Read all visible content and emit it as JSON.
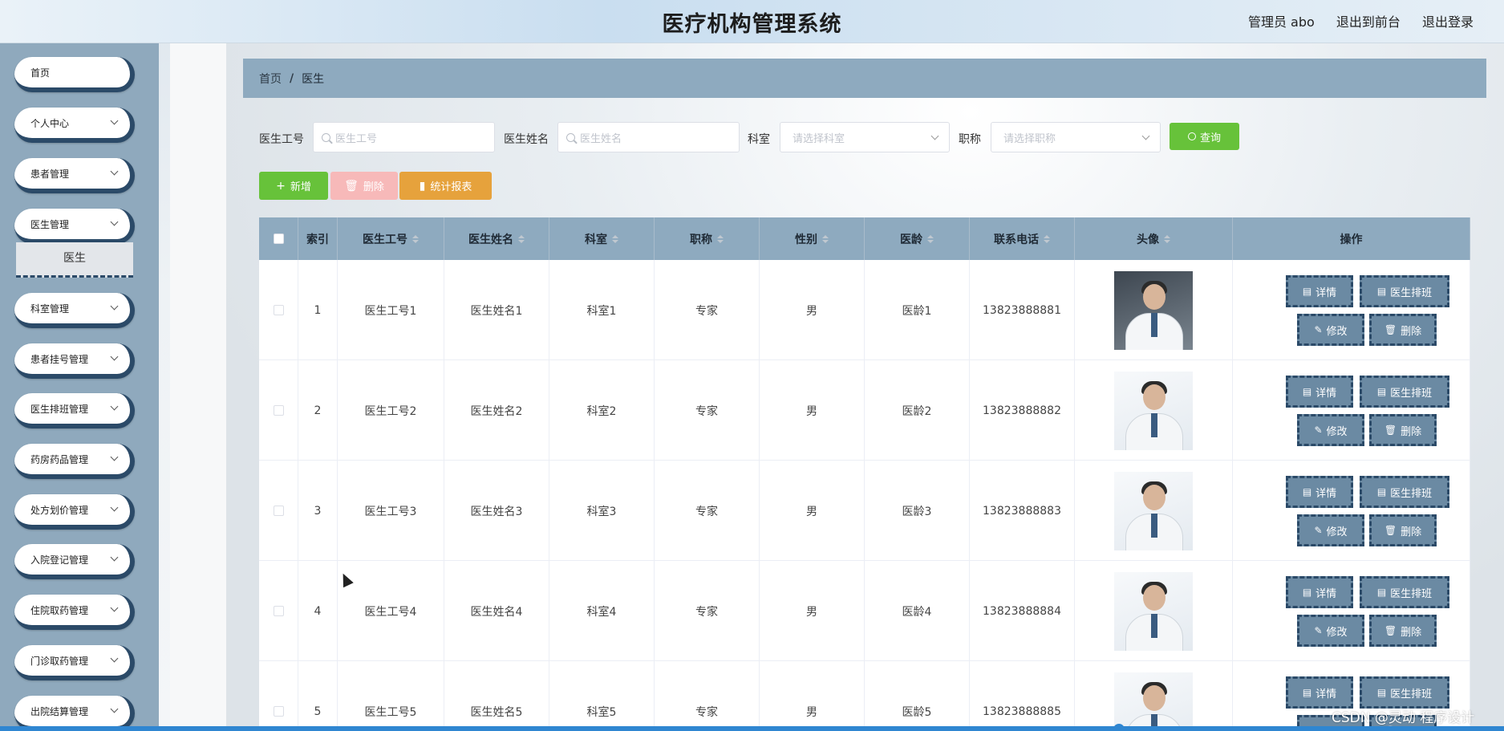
{
  "header": {
    "title": "医疗机构管理系统",
    "user": "管理员 abo",
    "links": [
      "退出到前台",
      "退出登录"
    ]
  },
  "sidebar": {
    "items": [
      {
        "label": "首页",
        "has_arrow": false
      },
      {
        "label": "个人中心",
        "has_arrow": true
      },
      {
        "label": "患者管理",
        "has_arrow": true
      },
      {
        "label": "医生管理",
        "has_arrow": true
      },
      {
        "label": "科室管理",
        "has_arrow": true
      },
      {
        "label": "患者挂号管理",
        "has_arrow": true
      },
      {
        "label": "医生排班管理",
        "has_arrow": true
      },
      {
        "label": "药房药品管理",
        "has_arrow": true
      },
      {
        "label": "处方划价管理",
        "has_arrow": true
      },
      {
        "label": "入院登记管理",
        "has_arrow": true
      },
      {
        "label": "住院取药管理",
        "has_arrow": true
      },
      {
        "label": "门诊取药管理",
        "has_arrow": true
      },
      {
        "label": "出院结算管理",
        "has_arrow": true
      }
    ],
    "active_sub": "医生"
  },
  "breadcrumb": {
    "home": "首页",
    "separator": "/",
    "current": "医生"
  },
  "search": {
    "fields": [
      {
        "label": "医生工号",
        "placeholder": "医生工号",
        "type": "text"
      },
      {
        "label": "医生姓名",
        "placeholder": "医生姓名",
        "type": "text"
      },
      {
        "label": "科室",
        "placeholder": "请选择科室",
        "type": "select"
      },
      {
        "label": "职称",
        "placeholder": "请选择职称",
        "type": "select"
      }
    ],
    "query_label": "查询"
  },
  "toolbar": {
    "add": "新增",
    "delete": "删除",
    "report": "统计报表"
  },
  "table": {
    "headers": [
      "",
      "索引",
      "医生工号",
      "医生姓名",
      "科室",
      "职称",
      "性别",
      "医龄",
      "联系电话",
      "头像",
      "操作"
    ],
    "rows": [
      {
        "index": "1",
        "id": "医生工号1",
        "name": "医生姓名1",
        "dept": "科室1",
        "title": "专家",
        "gender": "男",
        "age": "医龄1",
        "phone": "13823888881"
      },
      {
        "index": "2",
        "id": "医生工号2",
        "name": "医生姓名2",
        "dept": "科室2",
        "title": "专家",
        "gender": "男",
        "age": "医龄2",
        "phone": "13823888882"
      },
      {
        "index": "3",
        "id": "医生工号3",
        "name": "医生姓名3",
        "dept": "科室3",
        "title": "专家",
        "gender": "男",
        "age": "医龄3",
        "phone": "13823888883"
      },
      {
        "index": "4",
        "id": "医生工号4",
        "name": "医生姓名4",
        "dept": "科室4",
        "title": "专家",
        "gender": "男",
        "age": "医龄4",
        "phone": "13823888884"
      },
      {
        "index": "5",
        "id": "医生工号5",
        "name": "医生姓名5",
        "dept": "科室5",
        "title": "专家",
        "gender": "男",
        "age": "医龄5",
        "phone": "13823888885"
      }
    ],
    "row_actions": {
      "detail": "详情",
      "schedule": "医生排班",
      "edit": "修改",
      "delete": "删除"
    }
  },
  "watermark": "CSDN @灵动 程序设计",
  "colors": {
    "accent": "#8eaabf",
    "success": "#67c23a",
    "warning": "#e6a23c",
    "danger_light": "#f7b9b9",
    "dark_border": "#2b4a68"
  }
}
